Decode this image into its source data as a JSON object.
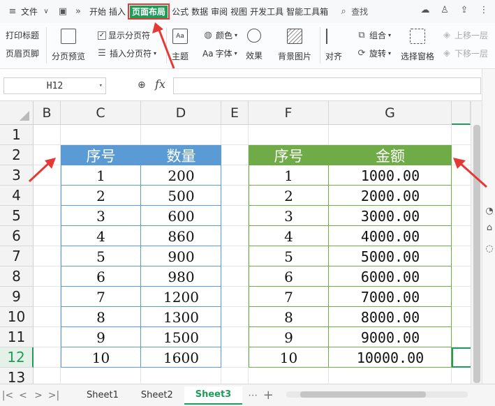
{
  "menu": {
    "file": "文件",
    "tabs": [
      "开始",
      "插入",
      "页面布局",
      "公式",
      "数据",
      "审阅",
      "视图",
      "开发工具",
      "智能工具箱"
    ],
    "active_tab": "页面布局",
    "search": "查找"
  },
  "ribbon": {
    "print_title": "打印标题",
    "header_footer": "页眉页脚",
    "page_break_preview": "分页预览",
    "show_page_break": "显示分页符",
    "insert_page_break": "插入分页符",
    "theme": "主题",
    "color": "颜色",
    "font": "字体",
    "font_prefix": "Aa",
    "effect": "效果",
    "background": "背景图片",
    "align": "对齐",
    "group": "组合",
    "rotate": "旋转",
    "select_pane": "选择窗格",
    "move_up": "上移一层",
    "move_down": "下移一层"
  },
  "formula_bar": {
    "name_box": "H12",
    "fx": "fx",
    "value": ""
  },
  "columns": [
    "B",
    "C",
    "D",
    "E",
    "F",
    "G"
  ],
  "rows": [
    "1",
    "2",
    "3",
    "4",
    "5",
    "6",
    "7",
    "8",
    "9",
    "10",
    "11",
    "12",
    "13"
  ],
  "selected_row": "12",
  "table1": {
    "headers": [
      "序号",
      "数量"
    ],
    "rows": [
      [
        "1",
        "200"
      ],
      [
        "2",
        "500"
      ],
      [
        "3",
        "600"
      ],
      [
        "4",
        "860"
      ],
      [
        "5",
        "900"
      ],
      [
        "6",
        "980"
      ],
      [
        "7",
        "1200"
      ],
      [
        "8",
        "1300"
      ],
      [
        "9",
        "1500"
      ],
      [
        "10",
        "1600"
      ]
    ],
    "color": "#5a9bd5"
  },
  "table2": {
    "headers": [
      "序号",
      "金额"
    ],
    "rows": [
      [
        "1",
        "1000.00"
      ],
      [
        "2",
        "2000.00"
      ],
      [
        "3",
        "3000.00"
      ],
      [
        "4",
        "4000.00"
      ],
      [
        "5",
        "5000.00"
      ],
      [
        "6",
        "6000.00"
      ],
      [
        "7",
        "7000.00"
      ],
      [
        "8",
        "8000.00"
      ],
      [
        "9",
        "9000.00"
      ],
      [
        "10",
        "10000.00"
      ]
    ],
    "color": "#6fab47"
  },
  "sheets": [
    "Sheet1",
    "Sheet2",
    "Sheet3"
  ],
  "active_sheet": "Sheet3",
  "colors": {
    "accent": "#1f9c5a",
    "highlight": "#e53935"
  }
}
